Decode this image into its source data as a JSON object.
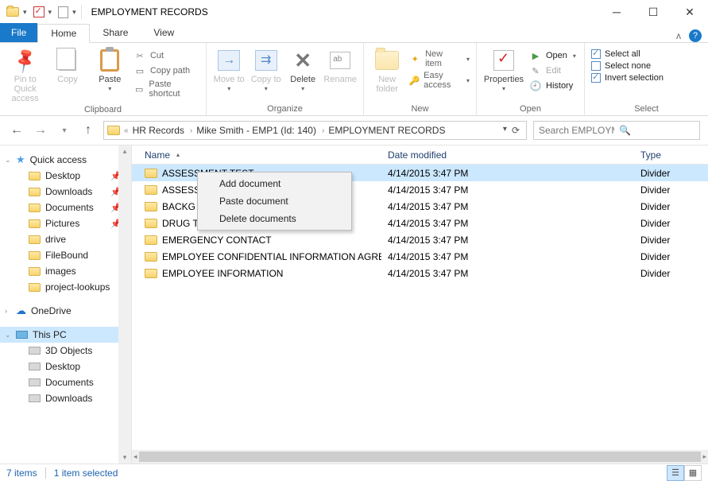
{
  "window": {
    "title": "EMPLOYMENT RECORDS"
  },
  "tabs": {
    "file": "File",
    "home": "Home",
    "share": "Share",
    "view": "View"
  },
  "ribbon": {
    "clipboard": {
      "label": "Clipboard",
      "pin": "Pin to Quick access",
      "copy": "Copy",
      "paste": "Paste",
      "cut": "Cut",
      "copy_path": "Copy path",
      "paste_shortcut": "Paste shortcut"
    },
    "organize": {
      "label": "Organize",
      "move_to": "Move to",
      "copy_to": "Copy to",
      "delete": "Delete",
      "rename": "Rename"
    },
    "new": {
      "label": "New",
      "new_folder": "New folder",
      "new_item": "New item",
      "easy_access": "Easy access"
    },
    "open": {
      "label": "Open",
      "properties": "Properties",
      "open": "Open",
      "edit": "Edit",
      "history": "History"
    },
    "select": {
      "label": "Select",
      "select_all": "Select all",
      "select_none": "Select none",
      "invert": "Invert selection"
    }
  },
  "breadcrumb": {
    "root_back": "«",
    "parts": [
      "HR Records",
      "Mike Smith - EMP1 (Id: 140)",
      "EMPLOYMENT RECORDS"
    ]
  },
  "search": {
    "placeholder": "Search EMPLOYMENT RECOR"
  },
  "sidebar": {
    "quick_access": "Quick access",
    "qa_items": [
      "Desktop",
      "Downloads",
      "Documents",
      "Pictures",
      "drive",
      "FileBound",
      "images",
      "project-lookups"
    ],
    "onedrive": "OneDrive",
    "this_pc": "This PC",
    "pc_items": [
      "3D Objects",
      "Desktop",
      "Documents",
      "Downloads"
    ]
  },
  "columns": {
    "name": "Name",
    "date": "Date modified",
    "type": "Type"
  },
  "files": [
    {
      "name": "ASSESSMENT TEST",
      "date": "4/14/2015 3:47 PM",
      "type": "Divider",
      "selected": true
    },
    {
      "name": "ASSESS",
      "date": "4/14/2015 3:47 PM",
      "type": "Divider"
    },
    {
      "name": "BACKG",
      "date": "4/14/2015 3:47 PM",
      "type": "Divider"
    },
    {
      "name": "DRUG T",
      "date": "4/14/2015 3:47 PM",
      "type": "Divider"
    },
    {
      "name": "EMERGENCY CONTACT",
      "date": "4/14/2015 3:47 PM",
      "type": "Divider"
    },
    {
      "name": "EMPLOYEE CONFIDENTIAL INFORMATION AGREE...",
      "date": "4/14/2015 3:47 PM",
      "type": "Divider"
    },
    {
      "name": "EMPLOYEE INFORMATION",
      "date": "4/14/2015 3:47 PM",
      "type": "Divider"
    }
  ],
  "context_menu": {
    "items": [
      "Add document",
      "Paste document",
      "Delete documents"
    ]
  },
  "status": {
    "count": "7 items",
    "selected": "1 item selected"
  }
}
